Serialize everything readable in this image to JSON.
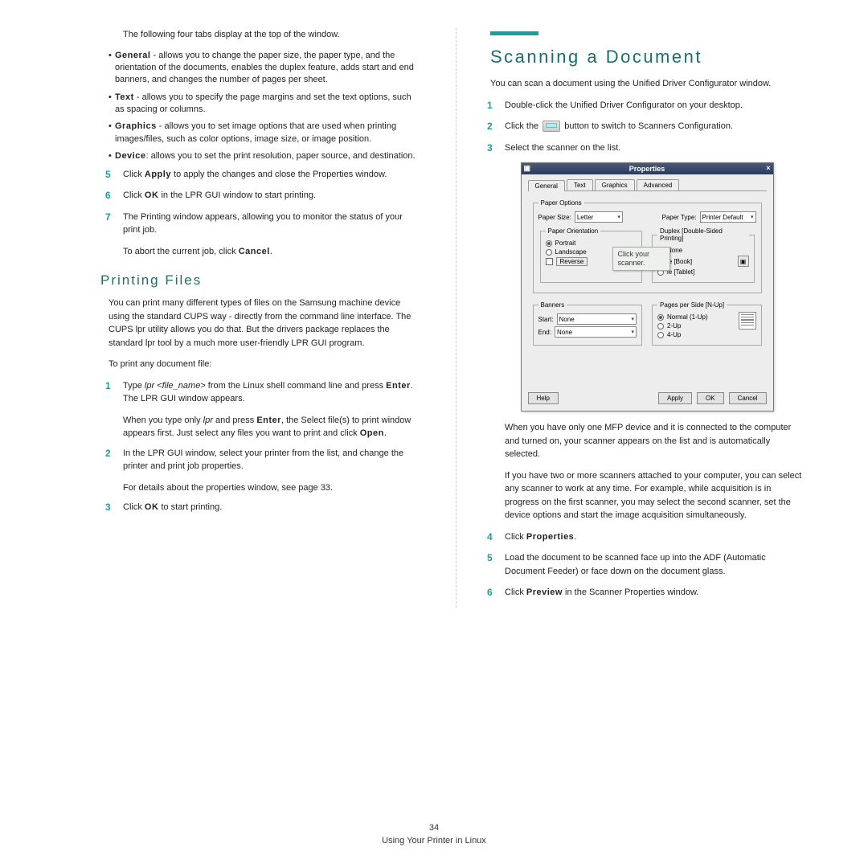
{
  "left": {
    "intro": "The following four tabs display at the top of the window.",
    "tabs": [
      {
        "name": "General",
        "desc": " - allows you to change the paper size, the paper type, and the orientation of the documents, enables the duplex feature, adds start and end banners, and changes the number of pages per sheet."
      },
      {
        "name": "Text",
        "desc": " - allows you to specify the page margins and set the text options, such as spacing or columns."
      },
      {
        "name": "Graphics",
        "desc": " - allows you to set image options that are used when printing images/files, such as color options, image size, or image position."
      },
      {
        "name": "Device",
        "desc": ": allows you to set the print resolution, paper source, and destination."
      }
    ],
    "steps_a": [
      {
        "n": "5",
        "pre": "Click ",
        "bold": "Apply",
        "post": " to apply the changes and close the Properties window."
      },
      {
        "n": "6",
        "pre": "Click ",
        "bold": "OK",
        "post": " in the LPR GUI window to start printing."
      },
      {
        "n": "7",
        "pre": "The Printing window appears, allowing you to monitor the status of your print job.",
        "bold": "",
        "post": ""
      }
    ],
    "abort": {
      "pre": "To abort the current job, click ",
      "bold": "Cancel",
      "post": "."
    },
    "section": "Printing Files",
    "para1": "You can print many different types of files on the Samsung machine device using the standard CUPS way - directly from the command line interface. The CUPS lpr utility allows you do that. But the drivers package replaces the standard lpr tool by a much more user-friendly LPR GUI program.",
    "para2": "To print any document file:",
    "steps_b": [
      {
        "n": "1",
        "text_pre": "Type ",
        "italic": "lpr <file_name>",
        "text_mid": " from the Linux shell command line and press ",
        "bold": "Enter",
        "text_post": ". The LPR GUI window appears.",
        "sub_pre": "When you type only ",
        "sub_italic": "lpr",
        "sub_mid": " and press ",
        "sub_bold": "Enter",
        "sub_post": ", the Select file(s) to print window appears first. Just select any files you want to print and click ",
        "sub_bold2": "Open",
        "sub_end": "."
      },
      {
        "n": "2",
        "text": "In the LPR GUI window, select your printer from the list, and change the printer and print job properties.",
        "sub": "For details about the properties window, see page 33."
      },
      {
        "n": "3",
        "text_pre": "Click ",
        "bold": "OK",
        "text_post": " to start printing."
      }
    ]
  },
  "right": {
    "title": "Scanning a Document",
    "intro": "You can scan a document using the Unified Driver Configurator window.",
    "steps": [
      {
        "n": "1",
        "text": "Double-click the Unified Driver Configurator on your desktop."
      },
      {
        "n": "2",
        "pre": "Click the ",
        "post": " button to switch to Scanners Configuration."
      },
      {
        "n": "3",
        "text": "Select the scanner on the list."
      }
    ],
    "after": [
      "When you have only one MFP device and it is connected to the computer and turned on, your scanner appears on the list and is automatically selected.",
      "If you have two or more scanners attached to your computer, you can select any scanner to work at any time. For example, while acquisition is in progress on the first scanner, you may select the second scanner, set the device options and start the image acquisition simultaneously."
    ],
    "steps2": [
      {
        "n": "4",
        "pre": "Click ",
        "bold": "Properties",
        "post": "."
      },
      {
        "n": "5",
        "text": "Load the document to be scanned face up into the ADF (Automatic Document Feeder) or face down on the document glass."
      },
      {
        "n": "6",
        "pre": "Click ",
        "bold": "Preview",
        "post": " in the Scanner Properties window."
      }
    ]
  },
  "props": {
    "title": "Properties",
    "tabs": [
      "General",
      "Text",
      "Graphics",
      "Advanced"
    ],
    "paperOptions": "Paper Options",
    "paperSize": "Paper Size:",
    "paperSizeVal": "Letter",
    "paperType": "Paper Type:",
    "paperTypeVal": "Printer Default",
    "orientation": "Paper Orientation",
    "portrait": "Portrait",
    "landscape": "Landscape",
    "reverse": "Reverse",
    "duplex": "Duplex [Double-Sided Printing]",
    "dnone": "None",
    "dbook": "ie [Book]",
    "dtablet": "ie [Tablet]",
    "banners": "Banners",
    "start": "Start:",
    "end": "End:",
    "none": "None",
    "pps": "Pages per Side [N-Up]",
    "normal": "Normal (1-Up)",
    "twoUp": "2-Up",
    "fourUp": "4-Up",
    "help": "Help",
    "apply": "Apply",
    "ok": "OK",
    "cancel": "Cancel",
    "callout": "Click your scanner."
  },
  "footer": {
    "page": "34",
    "text": "Using Your Printer in Linux"
  }
}
